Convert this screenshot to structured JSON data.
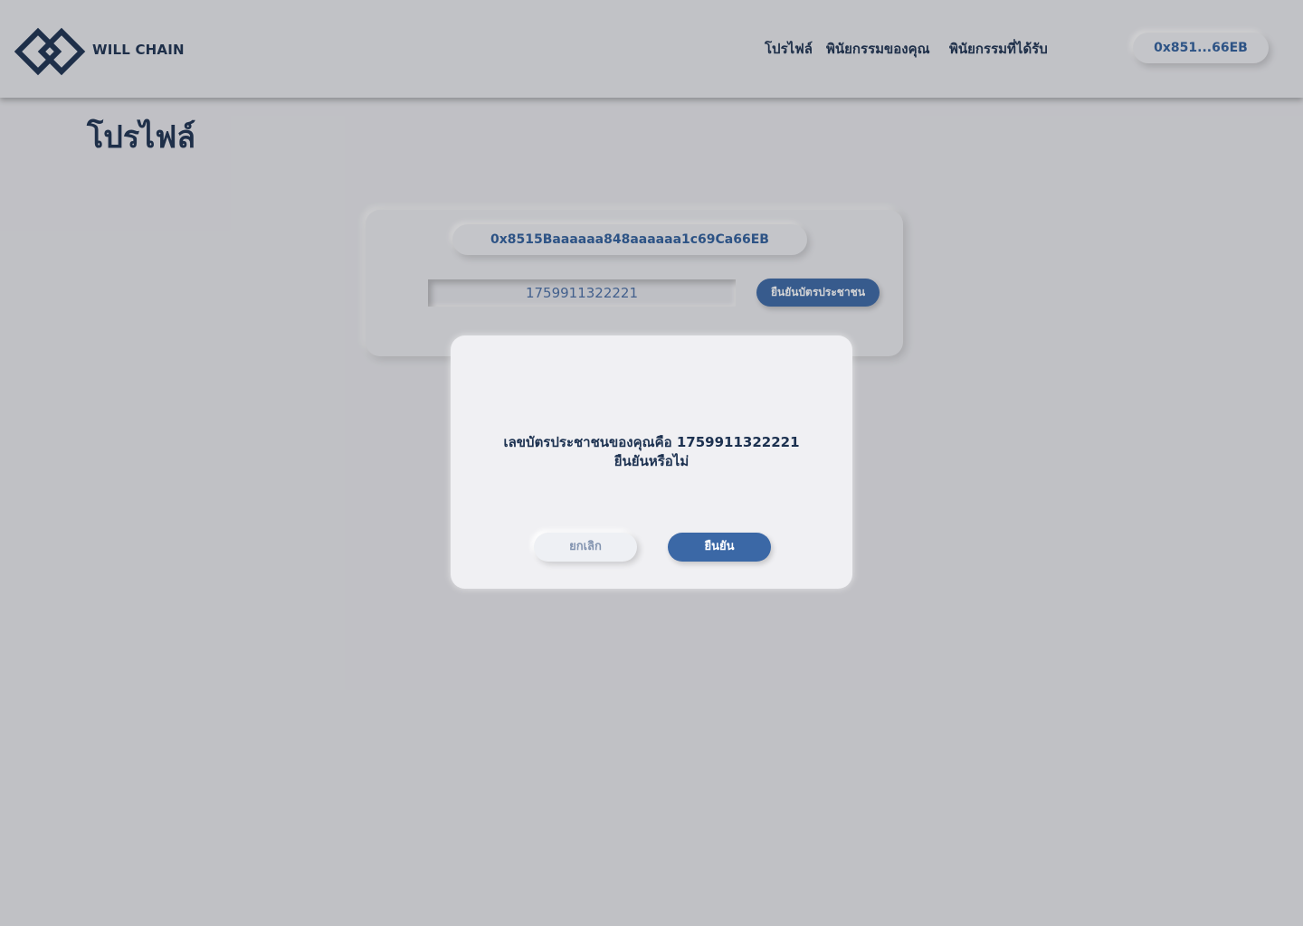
{
  "header": {
    "logo_text": "WILL CHAIN",
    "nav": [
      "โปรไฟล์",
      "พินัยกรรมของคุณ",
      "พินัยกรรมที่ได้รับ"
    ],
    "wallet_short": "0x851...66EB"
  },
  "page": {
    "title": "โปรไฟล์"
  },
  "card": {
    "address": "0x8515Baaaaaa848aaaaaa1c69Ca66EB",
    "id_value": "1759911322221",
    "verify_label": "ยืนยันบัตรประชาชน"
  },
  "modal": {
    "line1": "เลขบัตรประชาชนของคุณคือ 1759911322221",
    "line2": "ยืนยันหรือไม่",
    "cancel_label": "ยกเลิก",
    "confirm_label": "ยืนยัน"
  },
  "colors": {
    "primary": "#3b68a6",
    "text": "#1c3150",
    "accent_text": "#2f5e9b"
  }
}
